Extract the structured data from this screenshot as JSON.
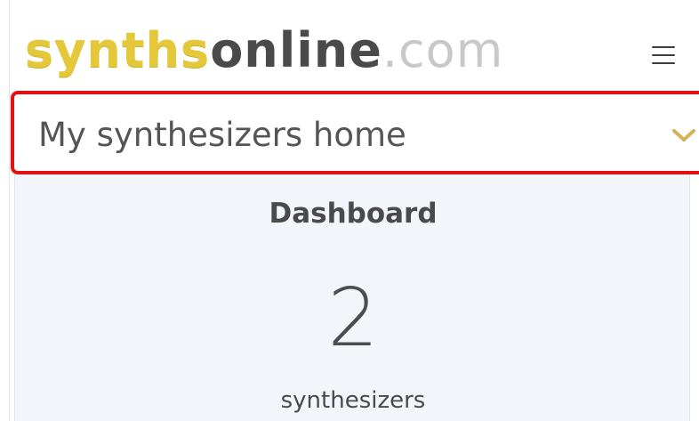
{
  "header": {
    "logo": {
      "part1": "synths",
      "part2": "online",
      "part3": ".com"
    },
    "menu_icon": "hamburger-menu-icon"
  },
  "home_selector": {
    "value": "My synthesizers home",
    "icon": "chevron-down-icon",
    "highlight_color": "#e21212"
  },
  "dashboard": {
    "title": "Dashboard",
    "stat_value": "2",
    "stat_label": "synthesizers"
  },
  "colors": {
    "brand_yellow": "#e5c83a",
    "brand_dark": "#4a4a4a",
    "brand_light": "#c8c8c8",
    "chevron": "#d2b25a",
    "panel_bg": "#f2f6fa"
  }
}
